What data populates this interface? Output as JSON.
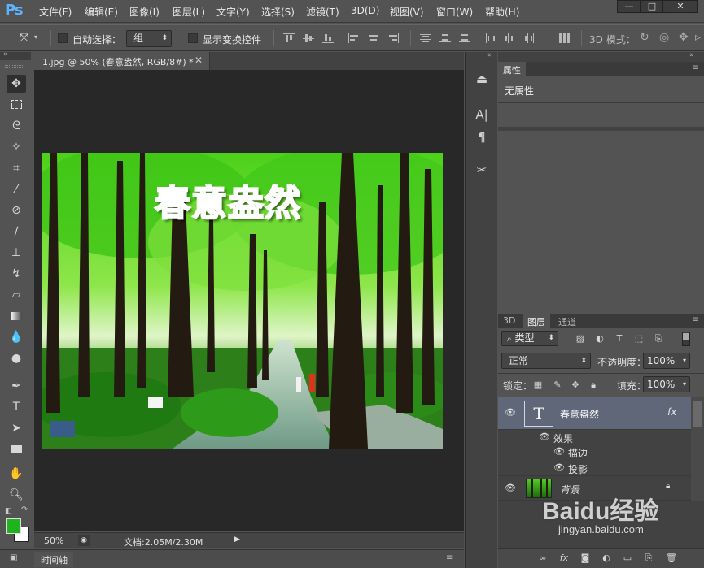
{
  "app": {
    "logo": "Ps"
  },
  "menu": [
    "文件(F)",
    "编辑(E)",
    "图像(I)",
    "图层(L)",
    "文字(Y)",
    "选择(S)",
    "滤镜(T)",
    "3D(D)",
    "视图(V)",
    "窗口(W)",
    "帮助(H)"
  ],
  "window_controls": {
    "minimize": "—",
    "maximize": "□",
    "close": "✕"
  },
  "options": {
    "auto_select_label": "自动选择：",
    "auto_select_value": "组",
    "show_transform_label": "显示变换控件",
    "mode_3d_label": "3D 模式："
  },
  "document": {
    "tab_title": "1.jpg @ 50% (春意盎然, RGB/8#) *",
    "tab_close": "✕",
    "image_text": "春意盎然",
    "zoom": "50%",
    "doc_info": "文档:2.05M/2.30M"
  },
  "timeline": {
    "label": "时间轴"
  },
  "properties": {
    "tab": "属性",
    "empty_text": "无属性"
  },
  "layers": {
    "tabs": [
      "3D",
      "图层",
      "通道"
    ],
    "filter_label": "类型",
    "blend_mode": "正常",
    "opacity_label": "不透明度：",
    "opacity_value": "100%",
    "lock_label": "锁定：",
    "fill_label": "填充：",
    "fill_value": "100%",
    "items": [
      {
        "name": "春意盎然",
        "thumb": "T",
        "fx": "fx",
        "effects_label": "效果",
        "effects": [
          "描边",
          "投影"
        ]
      },
      {
        "name": "背景"
      }
    ]
  },
  "watermark": {
    "brand": "Baidu经验",
    "url": "jingyan.baidu.com"
  },
  "colors": {
    "foreground": "#1fb31f",
    "background": "#ffffff",
    "title_fill": "#25c80a",
    "ps_blue": "#5db3ff"
  }
}
